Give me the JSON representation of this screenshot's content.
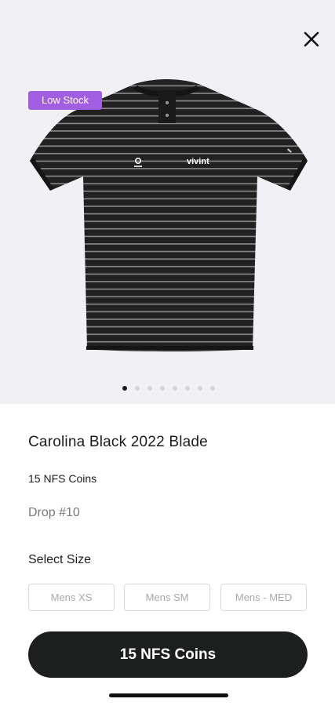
{
  "product": {
    "badge": "Low Stock",
    "title": "Carolina Black 2022 Blade",
    "price": "15 NFS Coins",
    "drop": "Drop #10",
    "shirt_brand_text": "vivint",
    "image_count": 8,
    "active_image_index": 0
  },
  "size_selector": {
    "heading": "Select Size",
    "options": [
      "Mens XS",
      "Mens SM",
      "Mens - MED"
    ]
  },
  "cta": {
    "label": "15 NFS Coins"
  },
  "icons": {
    "close": "close-icon",
    "shirt_logo": "logo-icon"
  },
  "colors": {
    "hero_background": "#f1f1f5",
    "badge_background": "#a25ee0",
    "button_background": "#1c1f1e",
    "text_primary": "#1c1c1c",
    "text_muted": "#7a7a7a",
    "border": "#d9d9dd",
    "shirt_body": "#212121",
    "shirt_stripe": "#8a8a8a"
  }
}
